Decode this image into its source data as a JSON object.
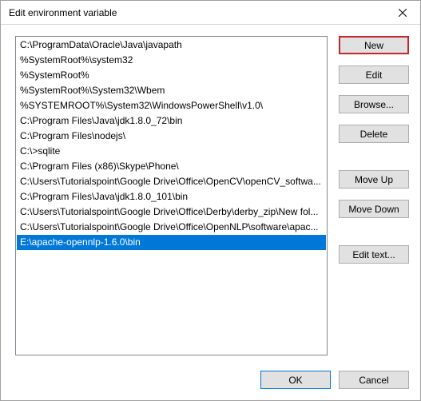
{
  "window": {
    "title": "Edit environment variable"
  },
  "list": {
    "items": [
      "C:\\ProgramData\\Oracle\\Java\\javapath",
      "%SystemRoot%\\system32",
      "%SystemRoot%",
      "%SystemRoot%\\System32\\Wbem",
      "%SYSTEMROOT%\\System32\\WindowsPowerShell\\v1.0\\",
      "C:\\Program Files\\Java\\jdk1.8.0_72\\bin",
      "C:\\Program Files\\nodejs\\",
      "C:\\>sqlite",
      "C:\\Program Files (x86)\\Skype\\Phone\\",
      "C:\\Users\\Tutorialspoint\\Google Drive\\Office\\OpenCV\\openCV_softwa...",
      "C:\\Program Files\\Java\\jdk1.8.0_101\\bin",
      "C:\\Users\\Tutorialspoint\\Google Drive\\Office\\Derby\\derby_zip\\New fol...",
      "C:\\Users\\Tutorialspoint\\Google Drive\\Office\\OpenNLP\\software\\apac...",
      "E:\\apache-opennlp-1.6.0\\bin"
    ],
    "selected_index": 13
  },
  "buttons": {
    "new": "New",
    "edit": "Edit",
    "browse": "Browse...",
    "delete": "Delete",
    "move_up": "Move Up",
    "move_down": "Move Down",
    "edit_text": "Edit text...",
    "ok": "OK",
    "cancel": "Cancel"
  },
  "highlighted_button": "new"
}
